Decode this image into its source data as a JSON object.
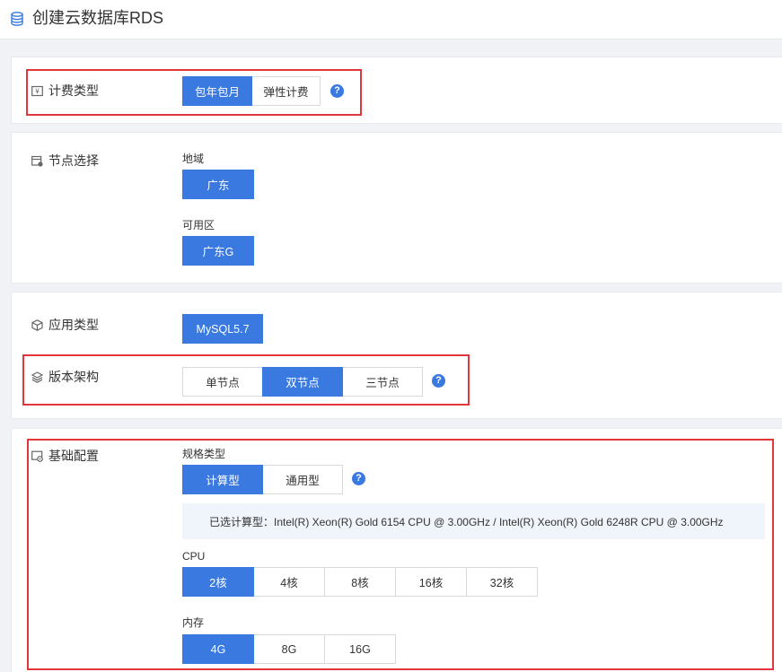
{
  "header": {
    "title": "创建云数据库RDS",
    "icon": "database-icon"
  },
  "billing": {
    "label": "计费类型",
    "icon": "billing-icon",
    "options": [
      "包年包月",
      "弹性计费"
    ],
    "selected": "包年包月"
  },
  "node": {
    "label": "节点选择",
    "icon": "node-icon",
    "region_label": "地域",
    "region_value": "广东",
    "zone_label": "可用区",
    "zone_value": "广东G"
  },
  "app": {
    "label": "应用类型",
    "icon": "cube-icon",
    "value": "MySQL5.7"
  },
  "version": {
    "label": "版本架构",
    "icon": "layers-icon",
    "options": [
      "单节点",
      "双节点",
      "三节点"
    ],
    "selected": "双节点"
  },
  "basic": {
    "label": "基础配置",
    "icon": "config-icon",
    "spec_label": "规格类型",
    "spec_options": [
      "计算型",
      "通用型"
    ],
    "spec_selected": "计算型",
    "spec_info": "已选计算型：Intel(R) Xeon(R) Gold 6154 CPU @ 3.00GHz / Intel(R) Xeon(R) Gold 6248R CPU @ 3.00GHz",
    "cpu_label": "CPU",
    "cpu_options": [
      "2核",
      "4核",
      "8核",
      "16核",
      "32核"
    ],
    "cpu_selected": "2核",
    "mem_label": "内存",
    "mem_options": [
      "4G",
      "8G",
      "16G"
    ],
    "mem_selected": "4G"
  },
  "help_symbol": "?",
  "colors": {
    "accent": "#3a79e0",
    "highlight": "#e0363c",
    "background": "#f0f2f5"
  }
}
